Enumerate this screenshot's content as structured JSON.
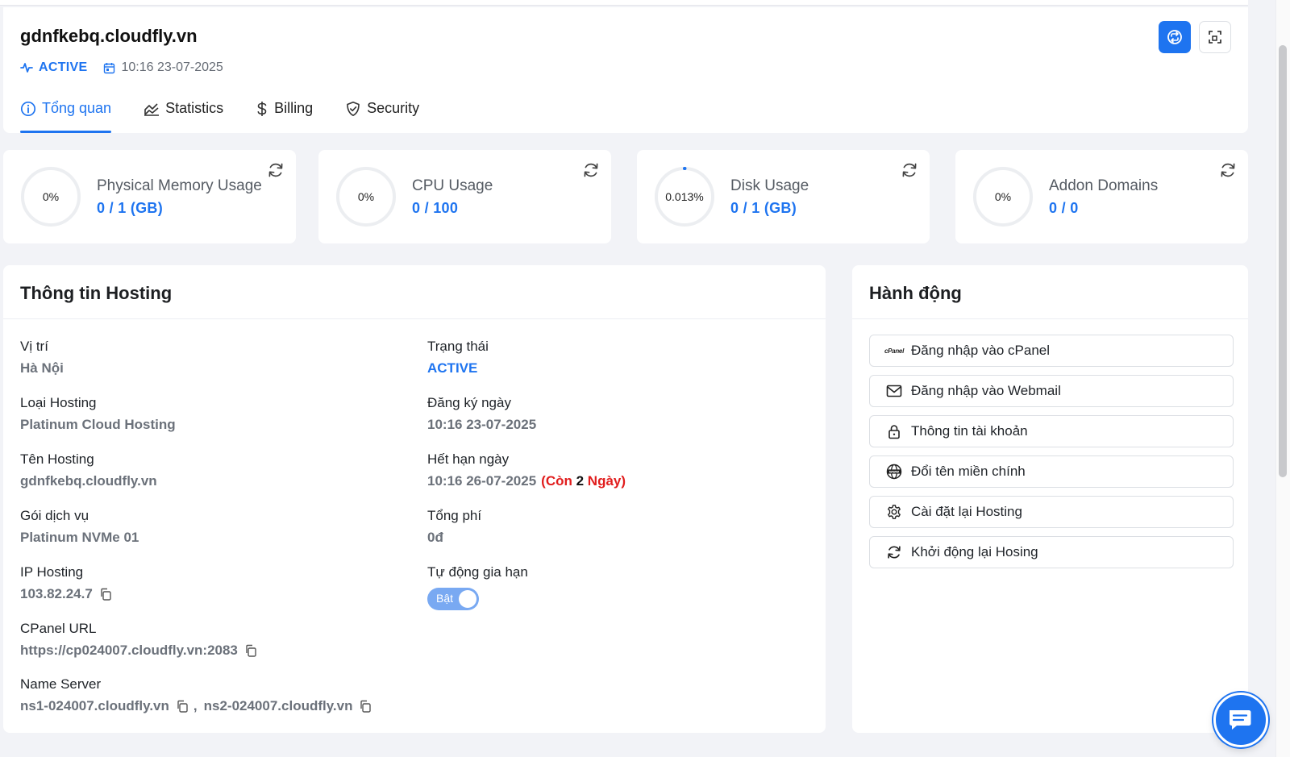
{
  "header": {
    "title": "gdnfkebq.cloudfly.vn",
    "status": "ACTIVE",
    "created": "10:16 23-07-2025"
  },
  "tabs": [
    {
      "label": "Tổng quan",
      "icon": "info-circle-icon",
      "active": true
    },
    {
      "label": "Statistics",
      "icon": "area-chart-icon",
      "active": false
    },
    {
      "label": "Billing",
      "icon": "dollar-icon",
      "active": false
    },
    {
      "label": "Security",
      "icon": "shield-check-icon",
      "active": false
    }
  ],
  "stats": [
    {
      "title": "Physical Memory Usage",
      "value": "0 / 1 (GB)",
      "percent_label": "0%",
      "percent": 0
    },
    {
      "title": "CPU Usage",
      "value": "0 / 100",
      "percent_label": "0%",
      "percent": 0
    },
    {
      "title": "Disk Usage",
      "value": "0 / 1 (GB)",
      "percent_label": "0.013%",
      "percent": 0.013
    },
    {
      "title": "Addon Domains",
      "value": "0 / 0",
      "percent_label": "0%",
      "percent": 0
    }
  ],
  "info": {
    "title": "Thông tin Hosting",
    "location": {
      "label": "Vị trí",
      "value": "Hà Nội"
    },
    "type": {
      "label": "Loại Hosting",
      "value": "Platinum Cloud Hosting"
    },
    "name": {
      "label": "Tên Hosting",
      "value": "gdnfkebq.cloudfly.vn"
    },
    "plan": {
      "label": "Gói dịch vụ",
      "value": "Platinum NVMe 01"
    },
    "ip": {
      "label": "IP Hosting",
      "value": "103.82.24.7"
    },
    "cpanel_url": {
      "label": "CPanel URL",
      "value": "https://cp024007.cloudfly.vn:2083"
    },
    "name_server": {
      "label": "Name Server",
      "ns1": "ns1-024007.cloudfly.vn",
      "separator": ",",
      "ns2": "ns2-024007.cloudfly.vn"
    },
    "status": {
      "label": "Trạng thái",
      "value": "ACTIVE"
    },
    "registered": {
      "label": "Đăng ký ngày",
      "value": "10:16 23-07-2025"
    },
    "expires": {
      "label": "Hết hạn ngày",
      "value": "10:16 26-07-2025",
      "remaining_prefix": "(Còn ",
      "remaining_days": "2",
      "remaining_suffix": " Ngày)"
    },
    "total_fee": {
      "label": "Tổng phí",
      "value": "0đ"
    },
    "auto_renew": {
      "label": "Tự động gia hạn",
      "toggle_text": "Bật",
      "enabled": true
    }
  },
  "actions": {
    "title": "Hành động",
    "cpanel_logo_text": "cPanel",
    "items": [
      {
        "label": "Đăng nhập vào cPanel",
        "icon": "cpanel-icon"
      },
      {
        "label": "Đăng nhập vào Webmail",
        "icon": "mail-icon"
      },
      {
        "label": "Thông tin tài khoản",
        "icon": "lock-icon"
      },
      {
        "label": "Đổi tên miền chính",
        "icon": "globe-www-icon"
      },
      {
        "label": "Cài đặt lại Hosting",
        "icon": "gear-icon"
      },
      {
        "label": "Khởi động lại Hosing",
        "icon": "refresh-icon"
      }
    ]
  },
  "colors": {
    "accent": "#1e74f0",
    "danger": "#e11d1d",
    "muted": "#6b717a",
    "background": "#f2f3f7"
  }
}
